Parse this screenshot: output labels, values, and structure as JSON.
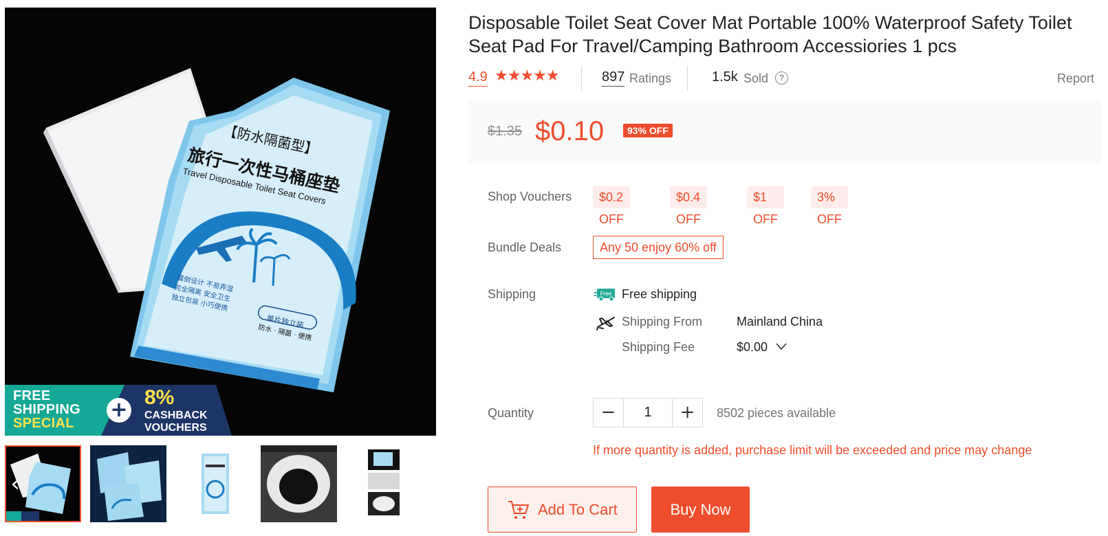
{
  "product": {
    "title": "Disposable Toilet Seat Cover Mat Portable 100% Waterproof Safety Toilet Seat Pad For Travel/Camping Bathroom Accessiories 1 pcs",
    "rating": "4.9",
    "stars": "★★★★★",
    "ratings_count": "897",
    "ratings_label": "Ratings",
    "sold_count": "1.5k",
    "sold_label": "Sold",
    "help_glyph": "?",
    "report_label": "Report"
  },
  "price": {
    "original": "$1.35",
    "current": "$0.10",
    "discount": "93% OFF"
  },
  "image": {
    "package_cn_1": "【防水隔菌型】",
    "package_cn_2": "旅行一次性马桶座垫",
    "package_en": "Travel Disposable Toilet Seat Covers",
    "package_points": [
      "露倒设计 不易弄湿",
      "完全隔离 安全卫生",
      "独立包装 小巧便携"
    ],
    "package_badge": "单片独立装",
    "package_footer": "防水 · 隔菌 · 便携"
  },
  "promo_banner": {
    "line1": "FREE",
    "line2": "SHIPPING",
    "line3": "SPECIAL",
    "plus": "+",
    "pct": "8%",
    "cash1": "CASHBACK",
    "cash2": "VOUCHERS"
  },
  "gallery": {
    "prev_arrow": "‹",
    "thumbnails": [
      "thumbnail-1",
      "thumbnail-2",
      "thumbnail-3",
      "thumbnail-4",
      "thumbnail-5"
    ],
    "selected_index": 0
  },
  "vouchers": {
    "label": "Shop Vouchers",
    "items": [
      "$0.2 OFF",
      "$0.4 OFF",
      "$1 OFF",
      "3% OFF"
    ]
  },
  "bundle": {
    "label": "Bundle Deals",
    "deal": "Any 50 enjoy 60% off"
  },
  "shipping": {
    "label": "Shipping",
    "free_badge": "Free",
    "free_text": "Free shipping",
    "from_label": "Shipping From",
    "from_value": "Mainland China",
    "fee_label": "Shipping Fee",
    "fee_value": "$0.00"
  },
  "quantity": {
    "label": "Quantity",
    "minus": "−",
    "value": "1",
    "plus": "+",
    "available": "8502 pieces available",
    "warning": "If more quantity is added, purchase limit will be exceeded and price may change"
  },
  "actions": {
    "add_to_cart": "Add To Cart",
    "buy_now": "Buy Now"
  },
  "colors": {
    "brand": "#ee4d2d",
    "muted": "#767676"
  }
}
